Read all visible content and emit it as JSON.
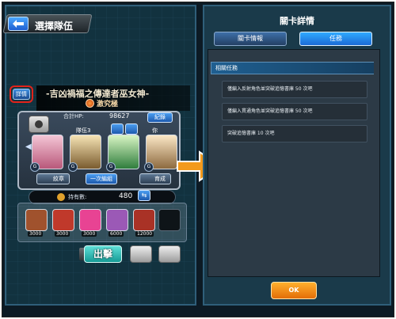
{
  "left_panel": {
    "back_label": "選擇隊伍",
    "detail_button": "詳情",
    "stage_name": "-吉凶禍福之傳達者巫女神-",
    "difficulty": "激究極",
    "hp_label": "合計HP:",
    "hp_value": "98627",
    "record_button": "紀錄",
    "team_name": "隊伍3",
    "friend_tag": "你",
    "badge_letter": "G",
    "crest_button": "紋章",
    "once_button": "一次編組",
    "grow_button": "育成",
    "owned_label": "持有數:",
    "owned_value": "480",
    "items": [
      {
        "qty": "3000",
        "color": "#a0522d"
      },
      {
        "qty": "3000",
        "color": "#c0392b"
      },
      {
        "qty": "3000",
        "color": "#e84393"
      },
      {
        "qty": "6000",
        "color": "#9b59b6"
      },
      {
        "qty": "12000",
        "color": "#a93226"
      }
    ],
    "sortie_button": "出擊"
  },
  "right_panel": {
    "title": "關卡詳情",
    "tabs": [
      "關卡情報",
      "任務"
    ],
    "section_title": "相關任務",
    "missions": [
      "僅編入反射角色並突破追憶書庫 50 次吧",
      "僅編入貫通角色並突破追憶書庫 50 次吧",
      "突破追憶書庫 10 次吧"
    ],
    "ok_button": "OK"
  },
  "colors": {
    "highlight_ring": "#e2231a",
    "arrow": "#f39a1c",
    "tab_active": "#2fa9ff"
  }
}
